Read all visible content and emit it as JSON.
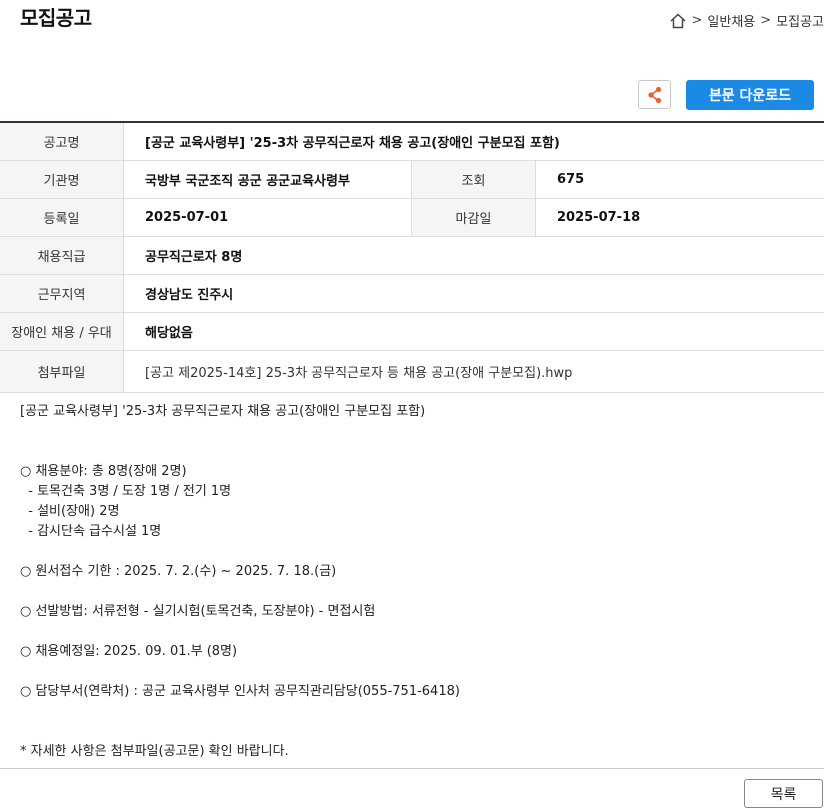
{
  "page": {
    "title": "모집공고"
  },
  "breadcrumb": {
    "home_icon": "home-icon",
    "sep": ">",
    "items": [
      "일반채용",
      "모집공고"
    ]
  },
  "toolbar": {
    "share_icon": "share-icon",
    "download_label": "본문 다운로드"
  },
  "info": {
    "title_label": "공고명",
    "title_value": "[공군 교육사령부] '25-3차 공무직근로자 채용 공고(장애인 구분모집 포함)",
    "agency_label": "기관명",
    "agency_value": "국방부 국군조직 공군 공군교육사령부",
    "views_label": "조회",
    "views_value": "675",
    "reg_label": "등록일",
    "reg_value": "2025-07-01",
    "deadline_label": "마감일",
    "deadline_value": "2025-07-18",
    "grade_label": "채용직급",
    "grade_value": "공무직근로자 8명",
    "region_label": "근무지역",
    "region_value": "경상남도 진주시",
    "disabled_label": "장애인 채용 / 우대",
    "disabled_value": "해당없음",
    "file_label": "첨부파일",
    "file_value": "[공고 제2025-14호] 25-3차 공무직근로자 등 채용 공고(장애 구분모집).hwp"
  },
  "body": {
    "lines": [
      "[공군 교육사령부] '25-3차 공무직근로자 채용 공고(장애인 구분모집 포함)",
      "",
      "",
      "○ 채용분야: 총 8명(장애 2명)",
      "  - 토목건축 3명 / 도장 1명 / 전기 1명",
      "  - 설비(장애) 2명",
      "  - 감시단속 급수시설 1명",
      "",
      "○ 원서접수 기한 : 2025. 7. 2.(수) ~ 2025. 7. 18.(금)",
      "",
      "○ 선발방법: 서류전형 - 실기시험(토목건축, 도장분야) - 면접시험",
      "",
      "○ 채용예정일: 2025. 09. 01.부 (8명)",
      "",
      "○ 담당부서(연락처) : 공군 교육사령부 인사처 공무직관리담당(055-751-6418)",
      "",
      "",
      "* 자세한 사항은 첨부파일(공고문) 확인 바랍니다."
    ]
  },
  "footer": {
    "list_label": "목록"
  }
}
